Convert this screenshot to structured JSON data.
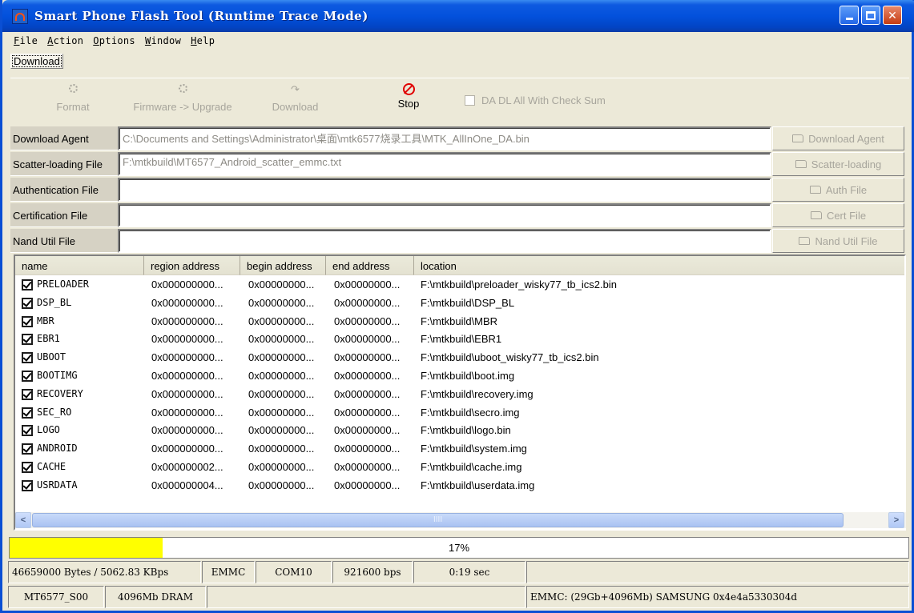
{
  "window": {
    "title": "Smart Phone Flash Tool (Runtime Trace Mode)"
  },
  "menu": [
    {
      "label": "File",
      "hot": "F",
      "rest": "ile"
    },
    {
      "label": "Action",
      "hot": "A",
      "rest": "ction"
    },
    {
      "label": "Options",
      "hot": "O",
      "rest": "ptions"
    },
    {
      "label": "Window",
      "hot": "W",
      "rest": "indow"
    },
    {
      "label": "Help",
      "hot": "H",
      "rest": "elp"
    }
  ],
  "tabs": {
    "download": "Download"
  },
  "toolbar": {
    "format": "Format",
    "firmware_upgrade": "Firmware -> Upgrade",
    "download": "Download",
    "stop": "Stop",
    "da_checksum": "DA DL All With Check Sum"
  },
  "files": {
    "download_agent": {
      "label": "Download Agent",
      "value": "C:\\Documents and Settings\\Administrator\\桌面\\mtk6577烧录工具\\MTK_AllInOne_DA.bin",
      "button": "Download Agent"
    },
    "scatter": {
      "label": "Scatter-loading File",
      "value": "F:\\mtkbuild\\MT6577_Android_scatter_emmc.txt",
      "button": "Scatter-loading"
    },
    "auth": {
      "label": "Authentication File",
      "value": "",
      "button": "Auth File"
    },
    "cert": {
      "label": "Certification File",
      "value": "",
      "button": "Cert File"
    },
    "nand": {
      "label": "Nand Util File",
      "value": "",
      "button": "Nand Util File"
    }
  },
  "table": {
    "columns": [
      "name",
      "region address",
      "begin address",
      "end address",
      "location"
    ],
    "rows": [
      {
        "name": "PRELOADER",
        "region": "0x000000000...",
        "begin": "0x00000000...",
        "end": "0x00000000...",
        "location": "F:\\mtkbuild\\preloader_wisky77_tb_ics2.bin"
      },
      {
        "name": "DSP_BL",
        "region": "0x000000000...",
        "begin": "0x00000000...",
        "end": "0x00000000...",
        "location": "F:\\mtkbuild\\DSP_BL"
      },
      {
        "name": "MBR",
        "region": "0x000000000...",
        "begin": "0x00000000...",
        "end": "0x00000000...",
        "location": "F:\\mtkbuild\\MBR"
      },
      {
        "name": "EBR1",
        "region": "0x000000000...",
        "begin": "0x00000000...",
        "end": "0x00000000...",
        "location": "F:\\mtkbuild\\EBR1"
      },
      {
        "name": "UBOOT",
        "region": "0x000000000...",
        "begin": "0x00000000...",
        "end": "0x00000000...",
        "location": "F:\\mtkbuild\\uboot_wisky77_tb_ics2.bin"
      },
      {
        "name": "BOOTIMG",
        "region": "0x000000000...",
        "begin": "0x00000000...",
        "end": "0x00000000...",
        "location": "F:\\mtkbuild\\boot.img"
      },
      {
        "name": "RECOVERY",
        "region": "0x000000000...",
        "begin": "0x00000000...",
        "end": "0x00000000...",
        "location": "F:\\mtkbuild\\recovery.img"
      },
      {
        "name": "SEC_RO",
        "region": "0x000000000...",
        "begin": "0x00000000...",
        "end": "0x00000000...",
        "location": "F:\\mtkbuild\\secro.img"
      },
      {
        "name": "LOGO",
        "region": "0x000000000...",
        "begin": "0x00000000...",
        "end": "0x00000000...",
        "location": "F:\\mtkbuild\\logo.bin"
      },
      {
        "name": "ANDROID",
        "region": "0x000000000...",
        "begin": "0x00000000...",
        "end": "0x00000000...",
        "location": "F:\\mtkbuild\\system.img"
      },
      {
        "name": "CACHE",
        "region": "0x000000002...",
        "begin": "0x00000000...",
        "end": "0x00000000...",
        "location": "F:\\mtkbuild\\cache.img"
      },
      {
        "name": "USRDATA",
        "region": "0x000000004...",
        "begin": "0x00000000...",
        "end": "0x00000000...",
        "location": "F:\\mtkbuild\\userdata.img"
      }
    ]
  },
  "scrollbar": {
    "grip": "IIII"
  },
  "progress": {
    "value": 0.17,
    "label": "17%",
    "color": "#ffff00"
  },
  "status1": {
    "bytes": "46659000 Bytes / 5062.83 KBps",
    "storage": "EMMC",
    "port": "COM10",
    "baud": "921600 bps",
    "elapsed": "0:19 sec",
    "extra": ""
  },
  "status2": {
    "chip": "MT6577_S00",
    "dram": "4096Mb DRAM",
    "blank": "",
    "emmc": "EMMC:  (29Gb+4096Mb) SAMSUNG 0x4e4a5330304d"
  },
  "colors": {
    "titlebar": "#0351dc",
    "window_bg": "#ece9d8",
    "progress": "#ffff00"
  }
}
